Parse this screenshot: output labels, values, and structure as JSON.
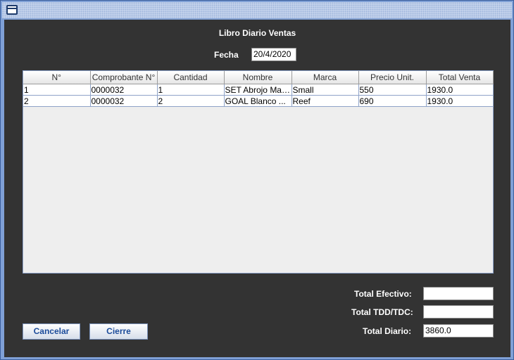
{
  "window": {
    "title": ""
  },
  "form": {
    "title": "Libro Diario Ventas",
    "fecha_label": "Fecha",
    "fecha_value": "20/4/2020"
  },
  "table": {
    "columns": [
      "N°",
      "Comprobante N°",
      "Cantidad",
      "Nombre",
      "Marca",
      "Precio Unit.",
      "Total Venta"
    ],
    "rows": [
      [
        "1",
        "0000032",
        "1",
        "SET Abrojo Mar...",
        "Small",
        "550",
        "1930.0"
      ],
      [
        "2",
        "0000032",
        "2",
        "GOAL Blanco ...",
        "Reef",
        "690",
        "1930.0"
      ]
    ]
  },
  "totals": {
    "efectivo_label": "Total Efectivo:",
    "efectivo_value": "",
    "tdd_label": "Total TDD/TDC:",
    "tdd_value": "",
    "diario_label": "Total Diario:",
    "diario_value": "3860.0"
  },
  "buttons": {
    "cancelar": "Cancelar",
    "cierre": "Cierre"
  },
  "icons": {
    "window_icon": "window-icon"
  }
}
